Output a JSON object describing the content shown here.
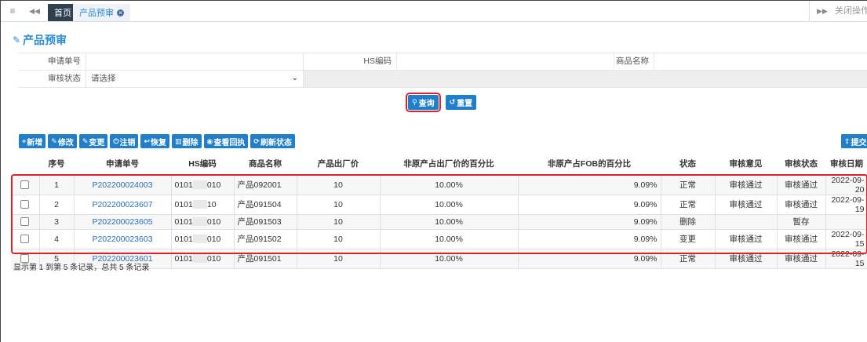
{
  "tabbar": {
    "menu_icon": "≡",
    "back_icon": "◀◀",
    "home_tab": "首页",
    "active_tab": "产品预审",
    "forward_icon": "▶▶",
    "close_ops": "关闭操作"
  },
  "page": {
    "title": "产品预审"
  },
  "form": {
    "apply_no_label": "申请单号",
    "apply_no_value": "",
    "hs_label": "HS编码",
    "hs_value": "",
    "goods_label": "商品名称",
    "goods_value": "",
    "status_label": "审核状态",
    "status_selected": "请选择"
  },
  "buttons": {
    "query": "查询",
    "reset": "重置"
  },
  "toolbar": {
    "add": "新增",
    "edit": "修改",
    "change": "变更",
    "cancel": "注销",
    "restore": "恢复",
    "delete": "删除",
    "view_receipt": "查看回执",
    "refresh_status": "刷新状态",
    "submit": "提交"
  },
  "table": {
    "headers": [
      "",
      "序号",
      "申请单号",
      "HS编码",
      "商品名称",
      "产品出厂价",
      "非原产占出厂价的百分比",
      "非原产占FOB的百分比",
      "状态",
      "审核意见",
      "审核状态",
      "审核日期"
    ],
    "rows": [
      {
        "seq": "1",
        "apply_no": "P202200024003",
        "hs_a": "0101",
        "hs_b": "010",
        "name": "产品092001",
        "price": "10",
        "pct_factory": "10.00%",
        "pct_fob": "9.09%",
        "status": "正常",
        "opinion": "审核通过",
        "audit": "审核通过",
        "date": "2022-09-20"
      },
      {
        "seq": "2",
        "apply_no": "P202200023607",
        "hs_a": "0101",
        "hs_b": "10",
        "name": "产品091504",
        "price": "10",
        "pct_factory": "10.00%",
        "pct_fob": "9.09%",
        "status": "正常",
        "opinion": "审核通过",
        "audit": "审核通过",
        "date": "2022-09-19"
      },
      {
        "seq": "3",
        "apply_no": "P202200023605",
        "hs_a": "0101",
        "hs_b": "010",
        "name": "产品091503",
        "price": "10",
        "pct_factory": "10.00%",
        "pct_fob": "9.09%",
        "status": "删除",
        "opinion": "",
        "audit": "暂存",
        "date": ""
      },
      {
        "seq": "4",
        "apply_no": "P202200023603",
        "hs_a": "0101",
        "hs_b": "010",
        "name": "产品091502",
        "price": "10",
        "pct_factory": "10.00%",
        "pct_fob": "9.09%",
        "status": "变更",
        "opinion": "审核通过",
        "audit": "审核通过",
        "date": "2022-09-15"
      },
      {
        "seq": "5",
        "apply_no": "P202200023601",
        "hs_a": "0101",
        "hs_b": "010",
        "name": "产品091501",
        "price": "10",
        "pct_factory": "10.00%",
        "pct_fob": "9.09%",
        "status": "正常",
        "opinion": "审核通过",
        "audit": "审核通过",
        "date": "2022-09-15"
      }
    ]
  },
  "pager": {
    "info": "显示第 1 到第 5 条记录，总共 5 条记录"
  },
  "colors": {
    "accent": "#1f7fcb",
    "highlight": "#e2202a",
    "link": "#2b6cb8"
  }
}
